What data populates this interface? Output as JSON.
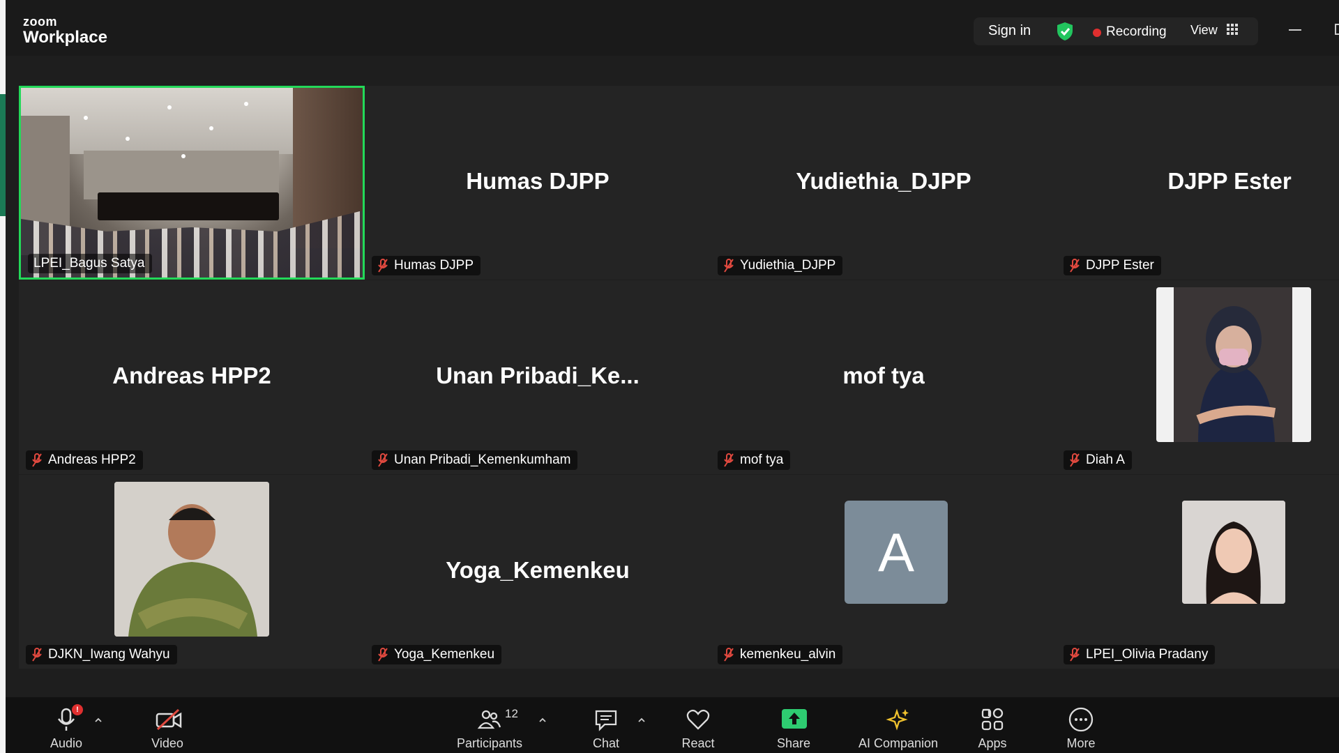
{
  "app": {
    "logo_line1": "zoom",
    "logo_line2": "Workplace"
  },
  "header": {
    "sign_in": "Sign in",
    "recording": "Recording",
    "view": "View"
  },
  "participants": [
    {
      "label": "LPEI_Bagus Satya",
      "display": "",
      "video": "conference-room",
      "active": true
    },
    {
      "label": "Humas DJPP",
      "display": "Humas DJPP"
    },
    {
      "label": "Yudiethia_DJPP",
      "display": "Yudiethia_DJPP"
    },
    {
      "label": "DJPP Ester",
      "display": "DJPP Ester"
    },
    {
      "label": "Andreas HPP2",
      "display": "Andreas HPP2"
    },
    {
      "label": "Unan Pribadi_Kemenkumham",
      "display": "Unan  Pribadi_Ke..."
    },
    {
      "label": "mof tya",
      "display": "mof tya"
    },
    {
      "label": "Diah A",
      "display": "",
      "video": "profile-photo"
    },
    {
      "label": "DJKN_Iwang Wahyu",
      "display": "",
      "video": "profile-photo"
    },
    {
      "label": "Yoga_Kemenkeu",
      "display": "Yoga_Kemenkeu"
    },
    {
      "label": "kemenkeu_alvin",
      "display": "",
      "avatar_letter": "A"
    },
    {
      "label": "LPEI_Olivia Pradany",
      "display": "",
      "video": "profile-photo"
    }
  ],
  "toolbar": {
    "audio": "Audio",
    "audio_badge": "!",
    "video": "Video",
    "participants": "Participants",
    "participants_count": "12",
    "chat": "Chat",
    "react": "React",
    "share": "Share",
    "ai_companion": "AI Companion",
    "apps": "Apps",
    "more": "More"
  },
  "colors": {
    "active_speaker_border": "#23d959",
    "recording_dot": "#e02f2f",
    "muted_icon": "#e0493f",
    "share_button": "#2ecc71",
    "ai_companion": "#f0c22e"
  }
}
